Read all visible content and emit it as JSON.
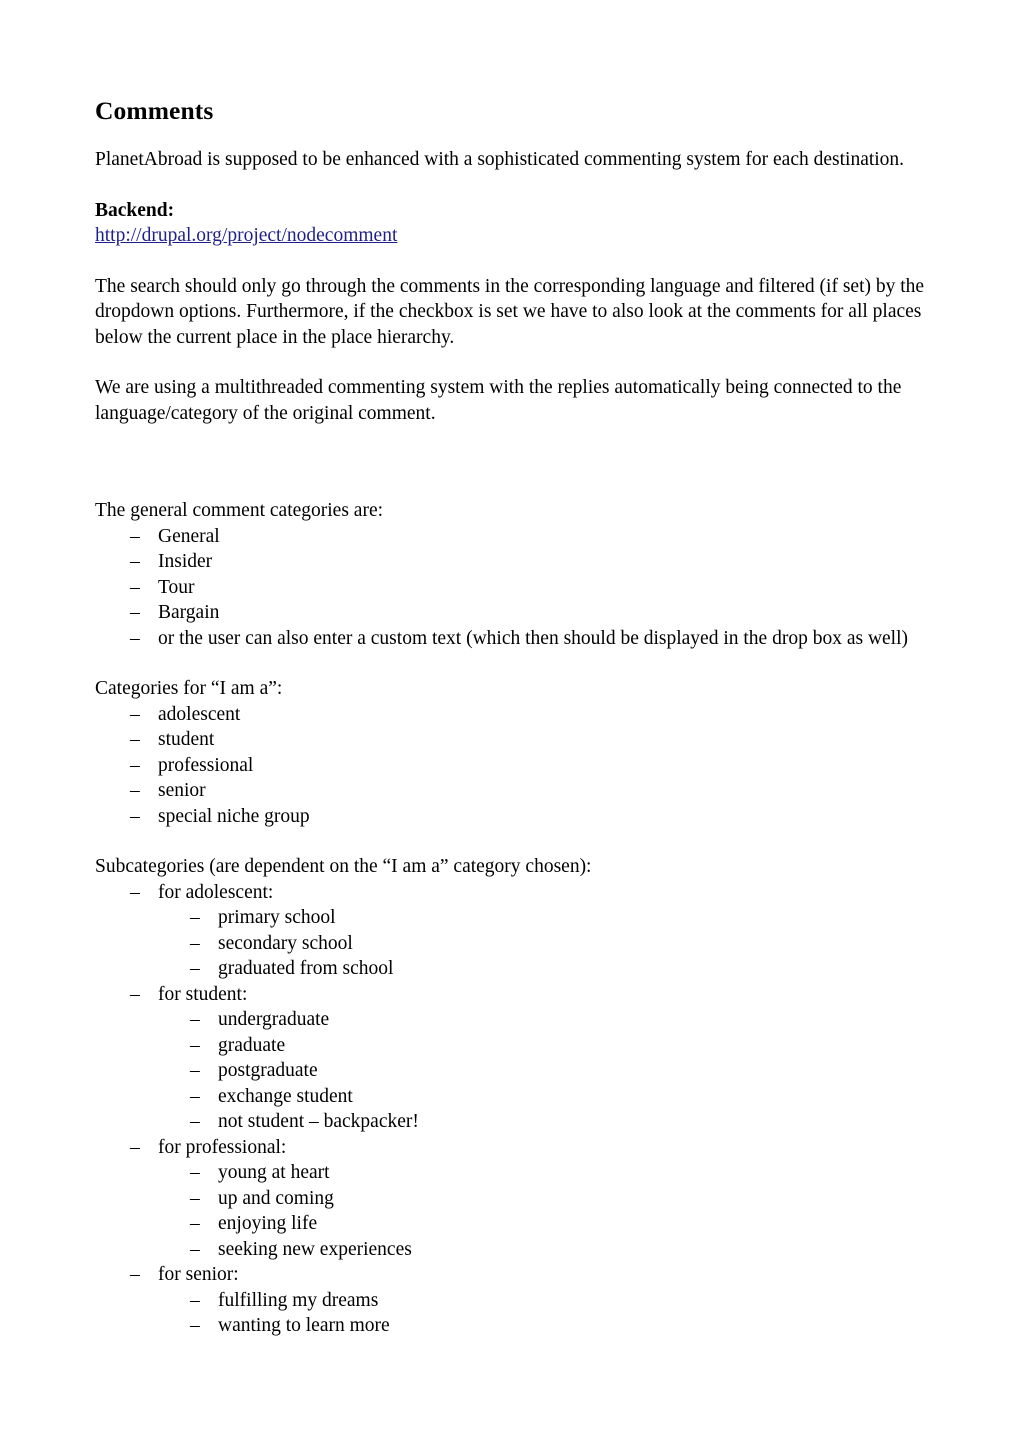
{
  "document": {
    "title": "Comments",
    "intro_paragraph": "PlanetAbroad is supposed to be enhanced with a sophisticated commenting system for each destination.",
    "backend_label": "Backend:",
    "backend_url": "http://drupal.org/project/nodecomment",
    "search_paragraph": "The search should only go through the comments in the corresponding language and filtered (if set) by the dropdown options. Furthermore, if the checkbox is set we have to also look at the comments for all places below the current place in the place hierarchy.",
    "multithread_paragraph": "We are using a multithreaded commenting system with the replies automatically being connected to the language/category of the original comment.",
    "bullet_glyph": "–",
    "link_color": "#1f1f8c"
  },
  "general_categories": {
    "heading": "The general comment categories are:",
    "items": [
      "General",
      "Insider",
      "Tour",
      "Bargain",
      "or the user can also enter a custom text (which then should be displayed in the drop box as well)"
    ]
  },
  "i_am_a": {
    "heading": "Categories for “I am a”:",
    "items": [
      "adolescent",
      "student",
      "professional",
      "senior",
      "special niche group"
    ]
  },
  "subcategories": {
    "heading": "Subcategories (are dependent on the “I am a” category chosen):",
    "groups": [
      {
        "label": "for adolescent:",
        "items": [
          "primary school",
          "secondary school",
          "graduated from school"
        ]
      },
      {
        "label": "for student:",
        "items": [
          "undergraduate",
          "graduate",
          "postgraduate",
          "exchange student",
          "not student – backpacker!"
        ]
      },
      {
        "label": "for professional:",
        "items": [
          "young at heart",
          "up and coming",
          "enjoying life",
          "seeking new experiences"
        ]
      },
      {
        "label": "for senior:",
        "items": [
          "fulfilling my dreams",
          "wanting to learn more"
        ]
      }
    ]
  }
}
